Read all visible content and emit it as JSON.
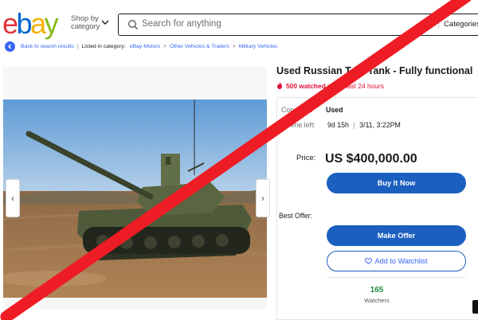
{
  "header": {
    "logo_letters": [
      {
        "ch": "e",
        "color": "#e53238"
      },
      {
        "ch": "b",
        "color": "#0064d2"
      },
      {
        "ch": "a",
        "color": "#f5af02"
      },
      {
        "ch": "y",
        "color": "#86b817"
      }
    ],
    "shop_by_line1": "Shop by",
    "shop_by_line2": "category",
    "search_placeholder": "Search for anything",
    "search_category": "Categories"
  },
  "breadcrumb": {
    "back_label": "Back to search results",
    "listed_in": "Listed in category:",
    "items": [
      "eBay Motors",
      "Other Vehicles & Trailers",
      "Military Vehicles"
    ]
  },
  "listing": {
    "title": "Used Russian T-72 Tank - Fully functional",
    "watched_prefix": "500 watched",
    "watched_suffix": "in the last 24 hours",
    "condition_label": "Condition:",
    "condition_value": "Used",
    "time_left_label": "Time left:",
    "time_left_value": "9d 15h",
    "time_left_end": "3/11, 3:22PM",
    "price_label": "Price:",
    "price_value": "US $400,000.00",
    "best_offer_label": "Best Offer:",
    "buy_it_now": "Buy It Now",
    "make_offer": "Make Offer",
    "add_to_watchlist": "Add to Watchlist",
    "watchers_count": "165",
    "watchers_label": "Watchers"
  },
  "image_nav": {
    "prev": "‹",
    "next": "›"
  },
  "colors": {
    "accent_blue": "#1b5fbf",
    "link_blue": "#3665f3",
    "alert_red": "#e0103a",
    "cross_red": "#ee1c24",
    "watchers_green": "#1e8a3e"
  }
}
